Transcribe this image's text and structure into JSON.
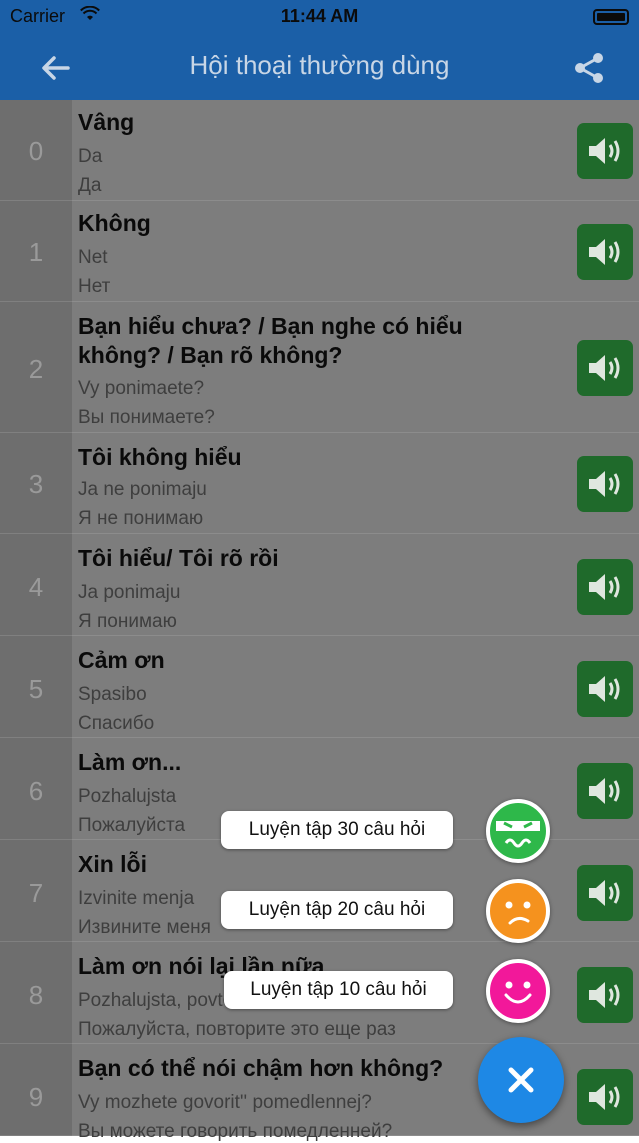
{
  "status_bar": {
    "carrier": "Carrier",
    "time": "11:44 AM"
  },
  "nav": {
    "title": "Hội thoại thường dùng",
    "back_icon": "arrow-left-icon",
    "share_icon": "share-icon"
  },
  "phrases": [
    {
      "num": "0",
      "vi": "Vâng",
      "tr": "Da",
      "ru": "Да"
    },
    {
      "num": "1",
      "vi": "Không",
      "tr": "Net",
      "ru": "Нет"
    },
    {
      "num": "2",
      "vi": "Bạn hiểu chưa? / Bạn nghe có hiểu không? / Bạn rõ không?",
      "tr": "Vy ponimaete?",
      "ru": "Вы понимаете?"
    },
    {
      "num": "3",
      "vi": "Tôi không hiểu",
      "tr": "Ja ne ponimaju",
      "ru": "Я не понимаю"
    },
    {
      "num": "4",
      "vi": "Tôi hiểu/ Tôi rõ rồi",
      "tr": "Ja ponimaju",
      "ru": "Я понимаю"
    },
    {
      "num": "5",
      "vi": "Cảm ơn",
      "tr": "Spasibo",
      "ru": "Спасибо"
    },
    {
      "num": "6",
      "vi": "Làm ơn...",
      "tr": "Pozhalujsta",
      "ru": "Пожалуйста"
    },
    {
      "num": "7",
      "vi": "Xin lỗi",
      "tr": "Izvinite menja",
      "ru": "Извините меня"
    },
    {
      "num": "8",
      "vi": "Làm ơn nói lại lần nữa",
      "tr": "Pozhalujsta, povtorite eto eshhe raz",
      "ru": "Пожалуйста, повторите это еще раз"
    },
    {
      "num": "9",
      "vi": "Bạn có thể nói chậm hơn không?",
      "tr": "Vy mozhete govorit'' pomedlennej?",
      "ru": "Вы можете говорить помедленней?"
    }
  ],
  "fab_menu": {
    "items": [
      {
        "label": "Luyện tập 30 câu hỏi",
        "icon": "sick-face-icon",
        "color": "#2eb84a"
      },
      {
        "label": "Luyện tập 20 câu hỏi",
        "icon": "confused-face-icon",
        "color": "#f5921e"
      },
      {
        "label": "Luyện tập 10 câu hỏi",
        "icon": "smiley-face-icon",
        "color": "#f2189a"
      }
    ],
    "close_icon": "close-icon",
    "main_color": "#1e88e5"
  }
}
